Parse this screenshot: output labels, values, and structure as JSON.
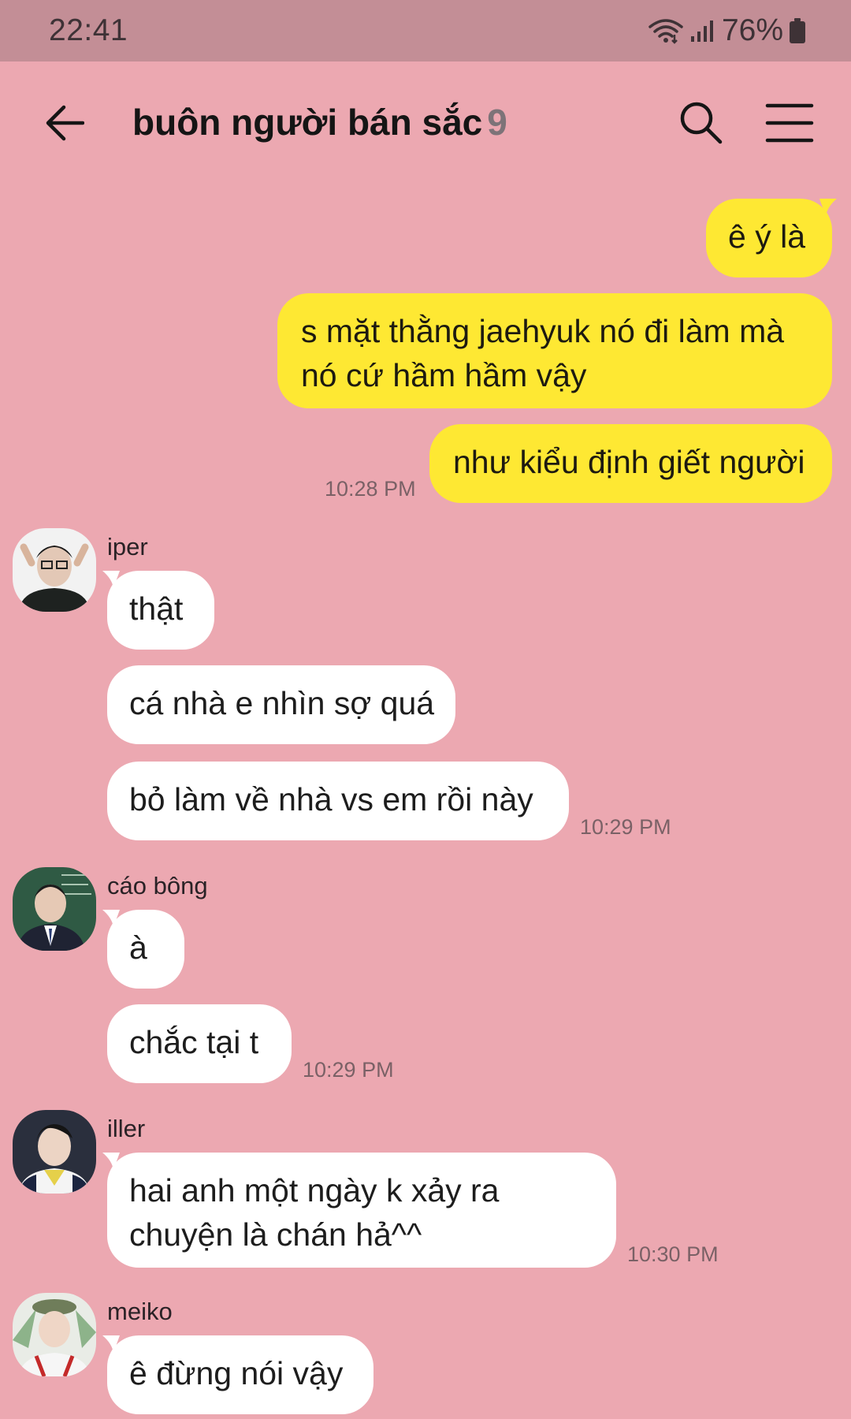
{
  "status_bar": {
    "time": "22:41",
    "battery": "76%"
  },
  "header": {
    "title": "buôn người bán sắc",
    "member_count": "9"
  },
  "icons": {
    "back": "arrow-left-icon",
    "search": "search-icon",
    "menu": "hamburger-menu-icon",
    "wifi": "wifi-icon",
    "signal": "signal-icon",
    "battery": "battery-icon"
  },
  "colors": {
    "background": "#eca8b1",
    "status_bar": "#c38e96",
    "outgoing_bubble": "#fee833",
    "incoming_bubble": "#ffffff"
  },
  "messages": [
    {
      "direction": "out",
      "text": "ê ý là"
    },
    {
      "direction": "out",
      "lines": [
        "s mặt thằng jaehyuk nó đi làm mà",
        "nó cứ hầm hầm vậy"
      ]
    },
    {
      "direction": "out",
      "text": "như kiểu định giết người",
      "time": "10:28 PM"
    }
  ],
  "groups": [
    {
      "sender": "iper",
      "messages": [
        "thật",
        "cá nhà e nhìn sợ quá",
        "bỏ làm về nhà vs em rồi này"
      ],
      "time": "10:29 PM"
    },
    {
      "sender": "cáo bông",
      "messages": [
        "à",
        "chắc tại t"
      ],
      "time": "10:29 PM"
    },
    {
      "sender": "iller",
      "lines": [
        "hai anh một ngày k xảy ra",
        "chuyện là chán hả^^"
      ],
      "time": "10:30 PM"
    },
    {
      "sender": "meiko",
      "messages": [
        "ê đừng nói vậy"
      ]
    }
  ]
}
